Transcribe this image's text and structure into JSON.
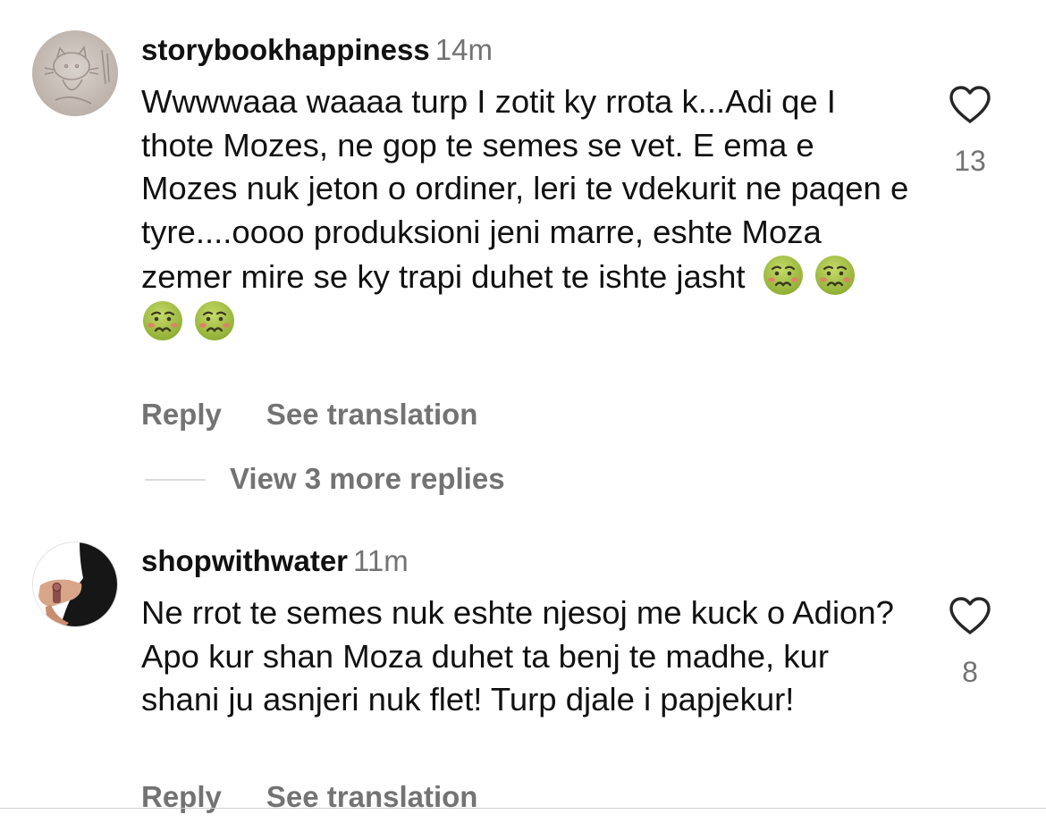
{
  "colors": {
    "text_primary": "#111111",
    "text_secondary": "#737373",
    "divider": "#dbdbdb"
  },
  "comments": [
    {
      "username": "storybookhappiness",
      "timestamp": "14m",
      "text": "Wwwwaaa waaaa turp I zotit ky rrota k...Adi qe I thote Mozes, ne gop te semes se vet. E ema e Mozes nuk jeton o ordiner, leri te vdekurit ne paqen e tyre....oooo produksioni jeni marre, eshte Moza zemer mire se ky trapi duhet te ishte jasht",
      "emojis": [
        "nauseated-face",
        "nauseated-face",
        "nauseated-face",
        "nauseated-face"
      ],
      "reply_label": "Reply",
      "translate_label": "See translation",
      "like_icon": "heart-outline-icon",
      "like_count": "13"
    },
    {
      "username": "shopwithwater",
      "timestamp": "11m",
      "text": "Ne rrot te semes nuk eshte njesoj me kuck o Adion? Apo kur shan Moza duhet ta benj te madhe, kur shani ju asnjeri nuk flet! Turp djale i papjekur!",
      "reply_label": "Reply",
      "translate_label": "See translation",
      "like_icon": "heart-outline-icon",
      "like_count": "8"
    }
  ],
  "view_more_replies": "View 3 more replies"
}
